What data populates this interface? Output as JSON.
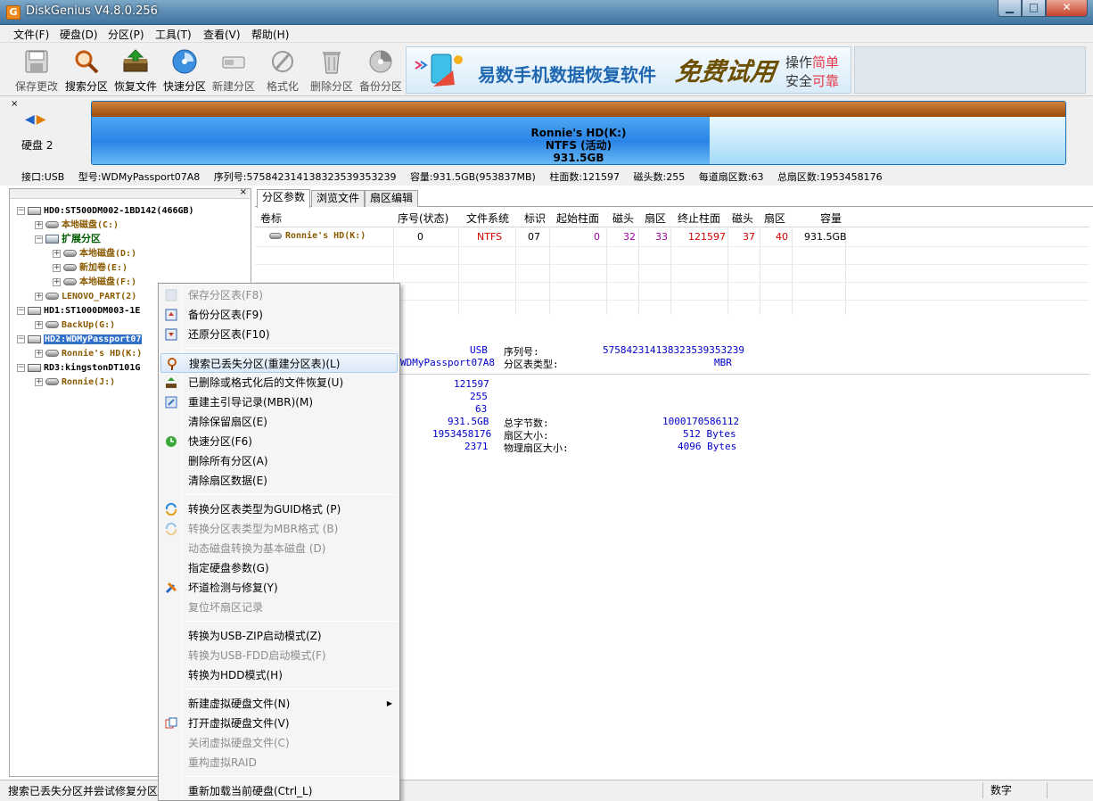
{
  "window": {
    "title": "DiskGenius V4.8.0.256",
    "app_icon": "G",
    "min_glyph": "▁",
    "max_glyph": "□",
    "close_glyph": "✕"
  },
  "menu": [
    "文件(F)",
    "硬盘(D)",
    "分区(P)",
    "工具(T)",
    "查看(V)",
    "帮助(H)"
  ],
  "toolbar": [
    {
      "label": "保存更改",
      "icon": "save-icon",
      "enabled": false
    },
    {
      "label": "搜索分区",
      "icon": "search-partition-icon",
      "enabled": true
    },
    {
      "label": "恢复文件",
      "icon": "recover-file-icon",
      "enabled": true
    },
    {
      "label": "快速分区",
      "icon": "quick-partition-icon",
      "enabled": true
    },
    {
      "label": "新建分区",
      "icon": "new-partition-icon",
      "enabled": false
    },
    {
      "label": "格式化",
      "icon": "format-icon",
      "enabled": false
    },
    {
      "label": "删除分区",
      "icon": "delete-partition-icon",
      "enabled": false
    },
    {
      "label": "备份分区",
      "icon": "backup-partition-icon",
      "enabled": false
    }
  ],
  "banner": {
    "main": "易数手机数据恢复软件",
    "mark": "免费试用",
    "line1a": "操作",
    "line1b": "简单",
    "line2a": "安全",
    "line2b": "可靠"
  },
  "diskbar": {
    "close": "×",
    "label": "硬盘 2",
    "partition_name": "Ronnie's HD(K:)",
    "partition_fs": "NTFS (活动)",
    "partition_size": "931.5GB",
    "used_fraction": 0.635,
    "info": [
      "接口:USB",
      "型号:WDMyPassport07A8",
      "序列号:575842314138323539353239",
      "容量:931.5GB(953837MB)",
      "柱面数:121597",
      "磁头数:255",
      "每道扇区数:63",
      "总扇区数:1953458176"
    ]
  },
  "tree": [
    {
      "label": "HD0:ST500DM002-1BD142(466GB)",
      "kind": "disk",
      "tog": "−",
      "selected": false
    },
    {
      "label": "本地磁盘(C:)",
      "kind": "part",
      "tog": "+",
      "selected": false
    },
    {
      "label": "扩展分区",
      "kind": "ext",
      "tog": "−",
      "selected": false
    },
    {
      "label": "本地磁盘(D:)",
      "kind": "part",
      "tog": "+",
      "selected": false
    },
    {
      "label": "新加卷(E:)",
      "kind": "part",
      "tog": "+",
      "selected": false
    },
    {
      "label": "本地磁盘(F:)",
      "kind": "part",
      "tog": "+",
      "selected": false
    },
    {
      "label": "LENOVO_PART(2)",
      "kind": "part",
      "tog": "+",
      "selected": false
    },
    {
      "label": "HD1:ST1000DM003-1E",
      "kind": "disk",
      "tog": "−",
      "selected": false
    },
    {
      "label": "BackUp(G:)",
      "kind": "part",
      "tog": "+",
      "selected": false
    },
    {
      "label": "HD2:WDMyPassport07",
      "kind": "disk",
      "tog": "−",
      "selected": true
    },
    {
      "label": "Ronnie's HD(K:)",
      "kind": "part",
      "tog": "+",
      "selected": false
    },
    {
      "label": "RD3:kingstonDT101G",
      "kind": "disk",
      "tog": "−",
      "selected": false
    },
    {
      "label": "Ronnie(J:)",
      "kind": "part",
      "tog": "+",
      "selected": false
    }
  ],
  "tabs": [
    "分区参数",
    "浏览文件",
    "扇区编辑"
  ],
  "grid": {
    "headers": [
      "卷标",
      "序号(状态)",
      "文件系统",
      "标识",
      "起始柱面",
      "磁头",
      "扇区",
      "终止柱面",
      "磁头",
      "扇区",
      "容量"
    ],
    "row": [
      "Ronnie's HD(K:)",
      "0",
      "NTFS",
      "07",
      "0",
      "32",
      "33",
      "121597",
      "37",
      "40",
      "931.5GB"
    ]
  },
  "details": {
    "v_usb": "USB",
    "v_model": "WDMyPassport07A8",
    "l_serial": "序列号:",
    "v_serial": "575842314138323539353239",
    "l_pt": "分区表类型:",
    "v_pt": "MBR",
    "v_cyl": "121597",
    "v_heads": "255",
    "v_spt": "63",
    "v_cap": "931.5GB",
    "l_totalbytes": "总字节数:",
    "v_totalbytes": "1000170586112",
    "v_totalsec": "1953458176",
    "l_secsize": "扇区大小:",
    "v_secsize": "512 Bytes",
    "v_extra": "2371",
    "l_physsec": "物理扇区大小:",
    "v_physsec": "4096 Bytes"
  },
  "context_menu": [
    {
      "label": "保存分区表(F8)",
      "enabled": false,
      "icon": "save-table-icon"
    },
    {
      "label": "备份分区表(F9)",
      "enabled": true,
      "icon": "backup-table-icon"
    },
    {
      "label": "还原分区表(F10)",
      "enabled": true,
      "icon": "restore-table-icon"
    },
    {
      "sep": true
    },
    {
      "label": "搜索已丢失分区(重建分区表)(L)",
      "enabled": true,
      "highlight": true,
      "icon": "search-lost-icon"
    },
    {
      "label": "已删除或格式化后的文件恢复(U)",
      "enabled": true,
      "icon": "recover-icon"
    },
    {
      "label": "重建主引导记录(MBR)(M)",
      "enabled": true,
      "icon": "mbr-icon"
    },
    {
      "label": "清除保留扇区(E)",
      "enabled": true
    },
    {
      "label": "快速分区(F6)",
      "enabled": true,
      "icon": "quick-partition-icon"
    },
    {
      "label": "删除所有分区(A)",
      "enabled": true
    },
    {
      "label": "清除扇区数据(E)",
      "enabled": true
    },
    {
      "sep": true
    },
    {
      "label": "转换分区表类型为GUID格式 (P)",
      "enabled": true,
      "icon": "convert-icon"
    },
    {
      "label": "转换分区表类型为MBR格式 (B)",
      "enabled": false,
      "icon": "convert-icon"
    },
    {
      "label": "动态磁盘转换为基本磁盘 (D)",
      "enabled": false
    },
    {
      "label": "指定硬盘参数(G)",
      "enabled": true
    },
    {
      "label": "坏道检测与修复(Y)",
      "enabled": true,
      "icon": "repair-icon"
    },
    {
      "label": "复位坏扇区记录",
      "enabled": false
    },
    {
      "sep": true
    },
    {
      "label": "转换为USB-ZIP启动模式(Z)",
      "enabled": true
    },
    {
      "label": "转换为USB-FDD启动模式(F)",
      "enabled": false
    },
    {
      "label": "转换为HDD模式(H)",
      "enabled": true
    },
    {
      "sep": true
    },
    {
      "label": "新建虚拟硬盘文件(N)",
      "enabled": true,
      "submenu": true
    },
    {
      "label": "打开虚拟硬盘文件(V)",
      "enabled": true,
      "icon": "open-virtual-icon"
    },
    {
      "label": "关闭虚拟硬盘文件(C)",
      "enabled": false
    },
    {
      "label": "重构虚拟RAID",
      "enabled": false
    },
    {
      "sep": true
    },
    {
      "label": "重新加载当前硬盘(Ctrl_L)",
      "enabled": true
    }
  ],
  "status": {
    "text": "搜索已丢失分区并尝试修复分区",
    "num": "数字"
  },
  "colors": {
    "accent": "#3170c8",
    "highlight": "#dbe9f9",
    "part_text": "#8a5a00",
    "ext_text": "#005a00",
    "purple": "#a000a0",
    "red": "#d40000",
    "blue_value": "#0000c8"
  }
}
